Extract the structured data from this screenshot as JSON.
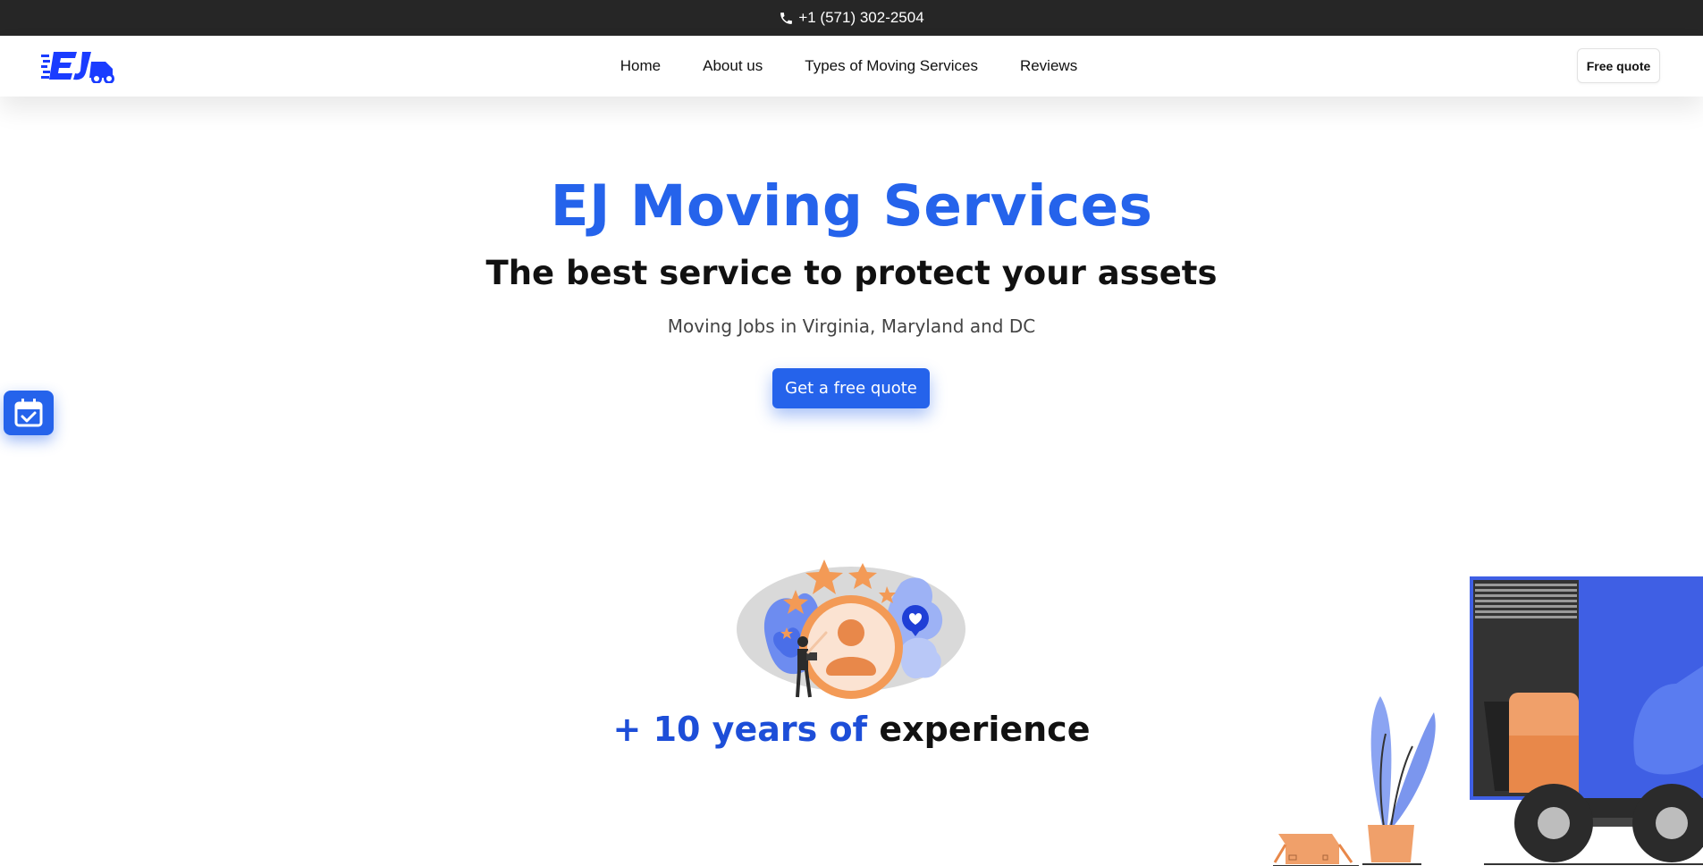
{
  "topbar": {
    "phone_icon": "phone-icon",
    "phone": "+1 (571) 302-2504"
  },
  "navbar": {
    "logo_text": "EJ",
    "links": [
      {
        "label": "Home"
      },
      {
        "label": "About us"
      },
      {
        "label": "Types of Moving Services"
      },
      {
        "label": "Reviews"
      }
    ],
    "quote_button": "Free quote"
  },
  "hero": {
    "title": "EJ Moving Services",
    "subtitle": "The best service to protect your assets",
    "text": "Moving Jobs in Virginia, Maryland and DC",
    "cta": "Get a free quote"
  },
  "floating": {
    "calendar_icon": "calendar-check-icon"
  },
  "experience": {
    "heading_blue": "+ 10 years of",
    "heading_dark": "experience"
  },
  "colors": {
    "brand_blue": "#2563eb",
    "topbar": "#262626",
    "orange": "#f0a06a",
    "truck_blue": "#3f5fe4"
  }
}
